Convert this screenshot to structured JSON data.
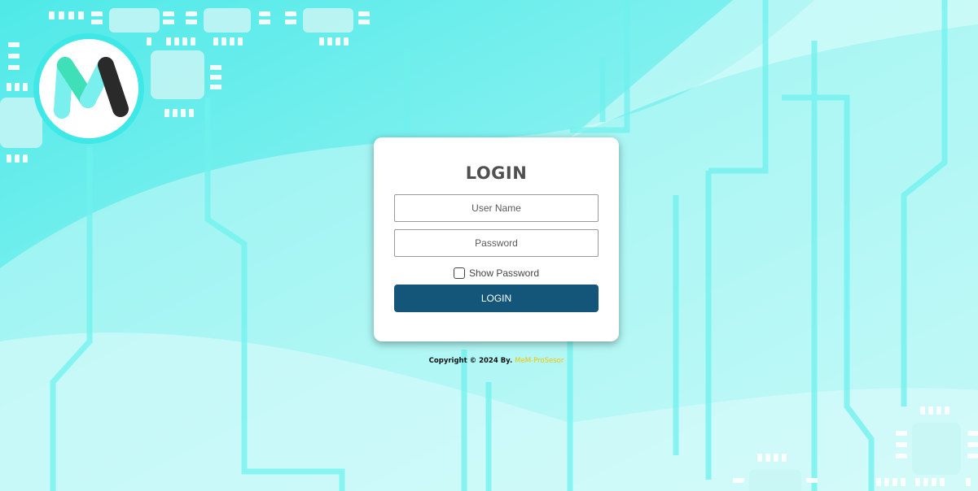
{
  "login_card": {
    "title": "LOGIN",
    "username_placeholder": "User Name",
    "password_placeholder": "Password",
    "show_password_label": "Show Password",
    "show_password_checked": false,
    "submit_label": "LOGIN"
  },
  "footer": {
    "copyright_prefix": "Copyright © 2024 By.",
    "brand": "MeM-ProSesor"
  },
  "icons": {
    "logo": "M-logo-icon"
  },
  "colors": {
    "accent_cyan": "#3ee8e6",
    "button": "#14567a",
    "title": "#505050",
    "brand": "#f2c400"
  }
}
